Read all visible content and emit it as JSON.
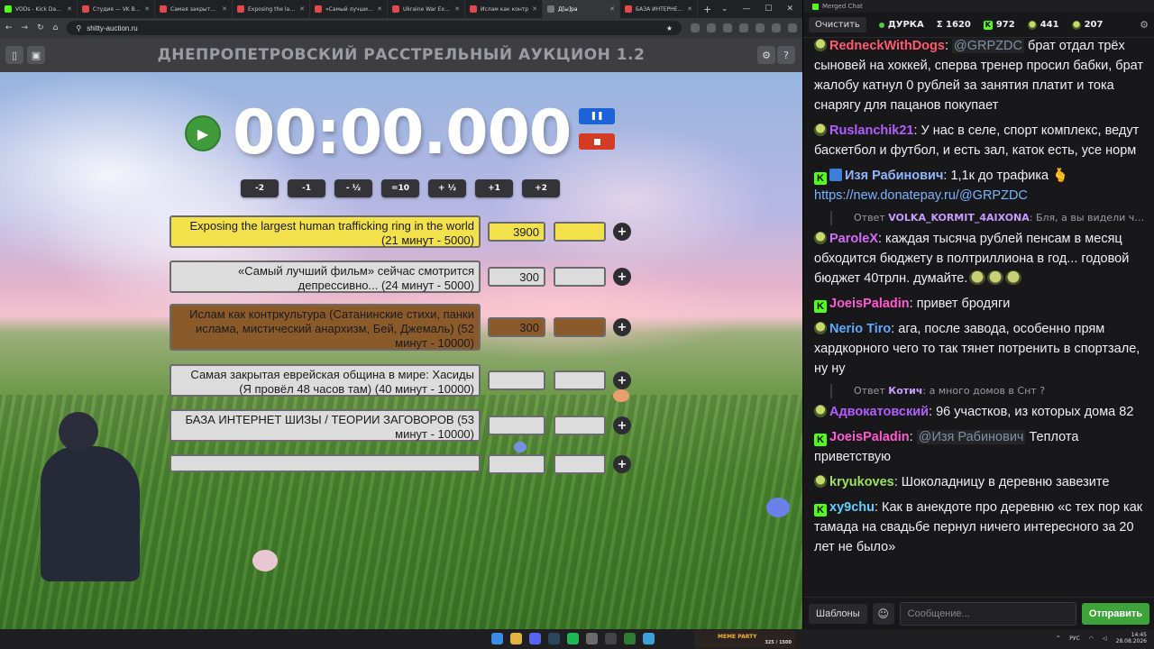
{
  "browser": {
    "tabs": [
      {
        "label": "VODs - Kick Dashbo",
        "color": "#53fc18",
        "active": false
      },
      {
        "label": "Студия — VK Видео",
        "color": "#e04a4a",
        "active": false
      },
      {
        "label": "Самая закрытая е",
        "color": "#e04a4a",
        "active": false
      },
      {
        "label": "Exposing the large",
        "color": "#e04a4a",
        "active": false
      },
      {
        "label": "«Самый лучший ф",
        "color": "#e04a4a",
        "active": false
      },
      {
        "label": "Ukraine War Expo",
        "color": "#e04a4a",
        "active": false
      },
      {
        "label": "Ислам как контр",
        "color": "#e04a4a",
        "active": false
      },
      {
        "label": "Д[ы]ра",
        "color": "#777777",
        "active": true
      },
      {
        "label": "БАЗА ИНТЕРНЕТ Ш",
        "color": "#e04a4a",
        "active": false
      }
    ],
    "new_tab": "+",
    "url": "shitty-auction.ru"
  },
  "auction": {
    "title": "ДНЕПРОПЕТРОВСКИЙ РАССТРЕЛЬНЫЙ АУКЦИОН 1.2",
    "timer": "00:00.000",
    "adjust_buttons": [
      "-2",
      "-1",
      "- ½",
      "=10",
      "+ ½",
      "+1",
      "+2"
    ],
    "lots": [
      {
        "name": "Exposing the largest human trafficking ring in the world (21 минут - 5000)",
        "amount": "3900",
        "bg": "#f2e14a",
        "amt_bg": "#f2e14a"
      },
      {
        "name": "«Самый лучший фильм» сейчас смотрится депрессивно... (24 минут - 5000)",
        "amount": "300",
        "bg": "#dcdcdc",
        "amt_bg": "#dcdcdc"
      },
      {
        "name": "Ислам как контркультура (Сатанинские стихи, панки ислама, мистический анархизм,  Бей, Джемаль) (52 минут - 10000)",
        "amount": "300",
        "bg": "#8b5a2b",
        "amt_bg": "#8b5a2b"
      },
      {
        "name": "Самая закрытая еврейская община в мире: Хасиды (Я провёл 48 часов там) (40 минут - 10000)",
        "amount": "",
        "bg": "#dcdcdc",
        "amt_bg": "#dcdcdc"
      },
      {
        "name": "БАЗА ИНТЕРНЕТ ШИЗЫ / ТЕОРИИ ЗАГОВОРОВ (53 минут - 10000)",
        "amount": "",
        "bg": "#dcdcdc",
        "amt_bg": "#dcdcdc"
      },
      {
        "name": "",
        "amount": "",
        "bg": "#dcdcdc",
        "amt_bg": "#dcdcdc"
      }
    ],
    "plus_label": "+"
  },
  "chat": {
    "window_title": "Merged Chat",
    "clear_label": "Очистить",
    "stats": [
      {
        "icon": "live-dot",
        "value": "ДУРКА"
      },
      {
        "icon": "sigma",
        "value": "Σ 1620"
      },
      {
        "icon": "kick",
        "value": "972"
      },
      {
        "icon": "pepe",
        "value": "441"
      },
      {
        "icon": "eye",
        "value": "207"
      }
    ],
    "messages": [
      {
        "type": "msg",
        "badge": "pepe",
        "nick": "RedneckWithDogs",
        "color": "#ff5a6e",
        "mention": "@GRPZDC",
        "text": " брат отдал трёх сыновей на хоккей, сперва тренер просил бабки, брат жалобу катнул 0 рублей за занятия платит и тока снарягу для пацанов покупает"
      },
      {
        "type": "msg",
        "badge": "pepe",
        "nick": "Ruslanchik21",
        "color": "#b45cff",
        "mention": "",
        "text": " У нас в селе, спорт комплекс, ведут баскетбол и футбол, и есть зал, каток есть, усе норм"
      },
      {
        "type": "msg",
        "badge": "kick-vip",
        "nick": "Изя Рабинович",
        "color": "#8fb8ff",
        "mention": "",
        "text": " 1,1к до трафика 🫰",
        "link": "https://new.donatepay.ru/@GRPZDC"
      },
      {
        "type": "reply",
        "prefix": "Ответ",
        "nick": "VOLKA_KORMIT_4AIXONA",
        "text": ": Бля, а вы видели че СР..."
      },
      {
        "type": "msg",
        "badge": "pepe",
        "nick": "ParoleX",
        "color": "#d46bff",
        "mention": "",
        "text": " каждая тысяча рублей пенсам в месяц обходится бюджету в полтриллиона в год... годовой бюджет 40трлн. думайте.",
        "emotes": 3
      },
      {
        "type": "msg",
        "badge": "kick",
        "nick": "JoeisPaladin",
        "color": "#ff5ad2",
        "mention": "",
        "text": " привет бродяги"
      },
      {
        "type": "msg",
        "badge": "pepe",
        "nick": "Nerio Tiro",
        "color": "#5fa8ff",
        "mention": "",
        "text": " ага, после завода, особенно прям хардкорного чего то так тянет потренить в спортзале, ну ну"
      },
      {
        "type": "reply",
        "prefix": "Ответ",
        "nick": "Котич",
        "text": ": а много домов в Снт ?"
      },
      {
        "type": "msg",
        "badge": "pepe",
        "nick": "Адвокатовский",
        "color": "#b45cff",
        "mention": "",
        "text": " 96 участков, из которых дома 82"
      },
      {
        "type": "msg",
        "badge": "kick",
        "nick": "JoeisPaladin",
        "color": "#ff5ad2",
        "mention": "@Изя Рабинович",
        "text": " Теплота приветствую"
      },
      {
        "type": "msg",
        "badge": "pepe",
        "nick": "kryukoves",
        "color": "#9ee060",
        "mention": "",
        "text": " Шоколадницу в деревню завезите"
      },
      {
        "type": "msg",
        "badge": "kick",
        "nick": "xy9chu",
        "color": "#5fd0ff",
        "mention": "",
        "text": " Как в анекдоте про деревню «с тех пор как тамада на свадьбе пернул ничего интересного за 20 лет не было»"
      }
    ],
    "templates_label": "Шаблоны",
    "input_placeholder": "Сообщение...",
    "send_label": "Отправить"
  },
  "taskbar": {
    "meme_party": "MEME PARTY",
    "meme_count": "325 / 1500",
    "lang": "РУС",
    "time": "14:45",
    "date": "28.08.2026"
  }
}
